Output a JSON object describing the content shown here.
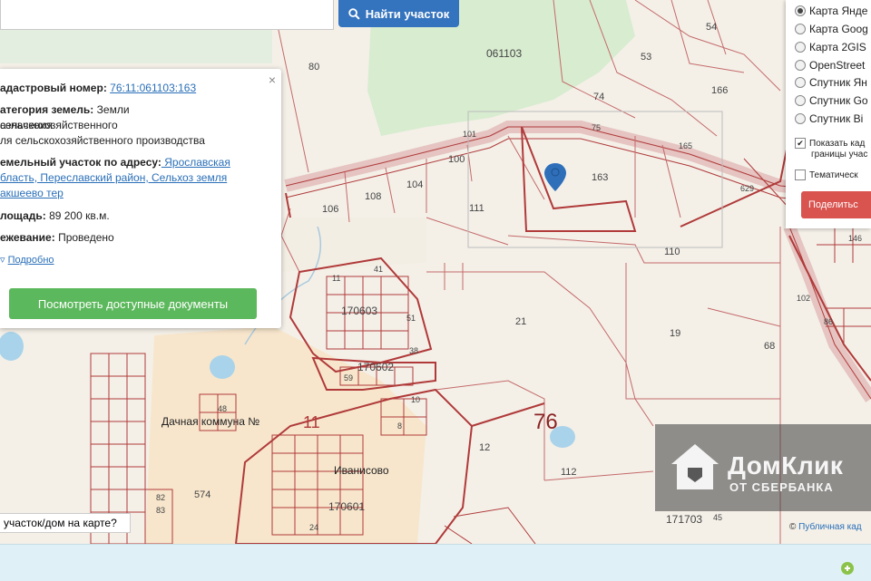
{
  "search": {
    "button_label": "Найти участок"
  },
  "popup": {
    "cadastral_label": "адастровый номер:",
    "cadastral_value": "76:11:061103:163",
    "category_label": "атегория земель:",
    "category_value_1": " Земли сельскохозяйственного",
    "category_value_2": "азначения",
    "category_value_3": "ля сельскохозяйственного производства",
    "address_label": "емельный участок по адресу:",
    "address_value_1": " Ярославская",
    "address_value_2": "бласть, Переславский район, Сельхоз земля",
    "address_value_3": "акшеево тер",
    "area_label": "лощадь:",
    "area_value": " 89 200 кв.м.",
    "survey_label": "ежевание:",
    "survey_value": " Проведено",
    "more_label": "Подробно",
    "docs_button": "Посмотреть доступные документы",
    "close_label": "×"
  },
  "layers": {
    "options": [
      {
        "label": "Карта Янде",
        "selected": true
      },
      {
        "label": "Карта Goog",
        "selected": false
      },
      {
        "label": "Карта 2GIS",
        "selected": false
      },
      {
        "label": "OpenStreet",
        "selected": false
      },
      {
        "label": "Спутник Ян",
        "selected": false
      },
      {
        "label": "Спутник Go",
        "selected": false
      },
      {
        "label": "Спутник Bi",
        "selected": false
      }
    ],
    "show_cadastral_1": "Показать кад",
    "show_cadastral_2": "границы учас",
    "thematic": "Тематическ",
    "share_button": "Поделитьс"
  },
  "map": {
    "labels": {
      "q061103": "061103",
      "n80": "80",
      "n54": "54",
      "n53": "53",
      "n166": "166",
      "n74": "74",
      "n75": "75",
      "n165": "165",
      "n101": "101",
      "n629": "629",
      "n100": "100",
      "n104": "104",
      "n108": "108",
      "n106": "106",
      "n111": "111",
      "n163": "163",
      "n110": "110",
      "n146": "146",
      "n102": "102",
      "q170603": "170603",
      "q170602": "170602",
      "n21": "21",
      "n19": "19",
      "n68": "68",
      "n41": "41",
      "n51": "51",
      "n38": "38",
      "n59": "59",
      "n11a": "11",
      "n10": "10",
      "n8": "8",
      "n48": "48",
      "n86": "86",
      "n12": "12",
      "n112": "112",
      "n574": "574",
      "n82": "82",
      "n83": "83",
      "n24": "24",
      "n45": "45",
      "q170601": "170601",
      "q171703": "171703",
      "dacha": "Дачная коммуна №",
      "big11": "11",
      "big76": "76",
      "ivanisovo": "Иванисово"
    }
  },
  "question_text": "участок/дом на карте?",
  "attribution": {
    "prefix": "© ",
    "link": "Публичная кад"
  },
  "watermark": {
    "main": "ДомКлик",
    "sub": "ОТ СБЕРБАНКА"
  },
  "colors": {
    "accent_blue": "#3473bd",
    "green_button": "#5cb85c",
    "red_button": "#d9534f",
    "parcel_red": "#b03a3a",
    "forest": "#d8ecd0"
  }
}
